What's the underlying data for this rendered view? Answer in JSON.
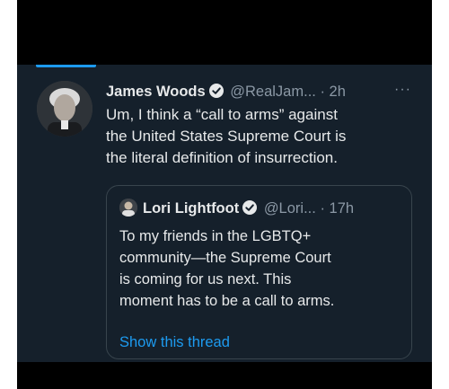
{
  "colors": {
    "background": "#15202b",
    "text": "#e7e9ea",
    "secondary_text": "#8b98a5",
    "accent": "#1d9bf0",
    "border": "#38444d"
  },
  "tweet": {
    "author_name": "James Woods",
    "verified_icon": "verified-badge-icon",
    "handle": "@RealJam...",
    "separator": "·",
    "time": "2h",
    "more_icon": "···",
    "lines": [
      "Um, I think a “call to arms” against",
      "the United States Supreme Court is",
      "the literal definition of insurrection."
    ]
  },
  "quoted_tweet": {
    "author_name": "Lori Lightfoot",
    "handle": "@Lori...",
    "separator": "·",
    "time": "17h",
    "lines": [
      "To my friends in the LGBTQ+",
      "community—the Supreme Court",
      "is coming for us next. This",
      "moment has to be a call to arms."
    ],
    "show_thread_label": "Show this thread"
  }
}
